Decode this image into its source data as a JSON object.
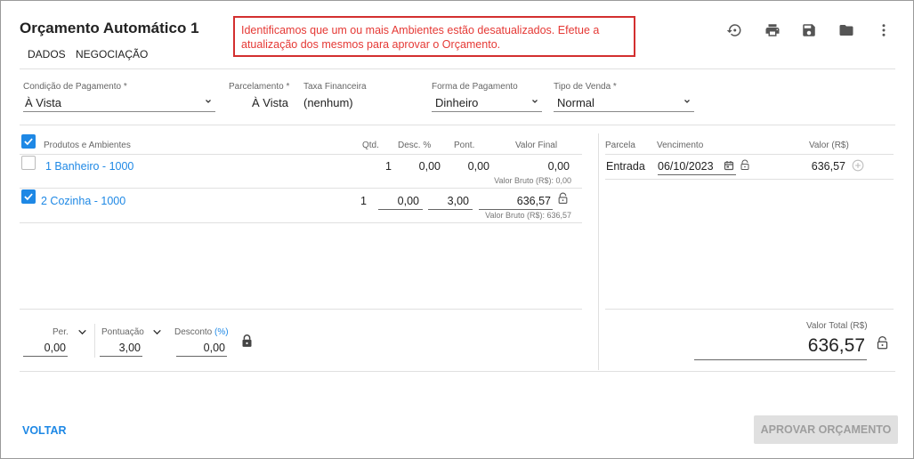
{
  "header": {
    "title": "Orçamento Automático 1",
    "tabs": [
      "DADOS",
      "NEGOCIAÇÃO"
    ],
    "alert": "Identificamos que um ou mais Ambientes estão desatualizados. Efetue a atualização dos mesmos para aprovar o Orçamento."
  },
  "toolbar": {
    "icons": [
      "history-icon",
      "print-icon",
      "save-icon",
      "folder-icon",
      "more-vert-icon"
    ]
  },
  "form": {
    "condicao": {
      "label": "Condição de Pagamento *",
      "value": "À Vista"
    },
    "parcelamento": {
      "label": "Parcelamento *",
      "value": "À Vista"
    },
    "taxa": {
      "label": "Taxa Financeira",
      "value": "(nenhum)"
    },
    "forma": {
      "label": "Forma de Pagamento",
      "value": "Dinheiro"
    },
    "tipo": {
      "label": "Tipo de Venda *",
      "value": "Normal"
    }
  },
  "products": {
    "headers": {
      "name": "Produtos e Ambientes",
      "qtd": "Qtd.",
      "desc": "Desc. %",
      "pont": "Pont.",
      "valor": "Valor Final"
    },
    "rows": [
      {
        "name": "1 Banheiro - 1000",
        "checked": false,
        "qtd": "1",
        "desc": "0,00",
        "pont": "0,00",
        "valor": "0,00",
        "bruto": "Valor Bruto (R$): 0,00"
      },
      {
        "name": "2 Cozinha - 1000",
        "checked": true,
        "qtd": "1",
        "desc": "0,00",
        "pont": "3,00",
        "valor": "636,57",
        "bruto": "Valor Bruto (R$): 636,57"
      }
    ]
  },
  "parcelas": {
    "headers": {
      "parcela": "Parcela",
      "vencimento": "Vencimento",
      "valor": "Valor (R$)"
    },
    "rows": [
      {
        "parcela": "Entrada",
        "vencimento": "06/10/2023",
        "valor": "636,57"
      }
    ]
  },
  "footer": {
    "per": {
      "label": "Per.",
      "value": "0,00"
    },
    "pontuacao": {
      "label": "Pontuação",
      "value": "3,00"
    },
    "desconto": {
      "label": "Desconto",
      "unit": "(%)",
      "value": "0,00"
    },
    "total": {
      "label": "Valor Total (R$)",
      "value": "636,57"
    }
  },
  "actions": {
    "voltar": "VOLTAR",
    "aprovar": "APROVAR ORÇAMENTO"
  },
  "colors": {
    "accent": "#1e88e5",
    "alert": "#e53935",
    "disabled_bg": "#e0e0e0"
  }
}
